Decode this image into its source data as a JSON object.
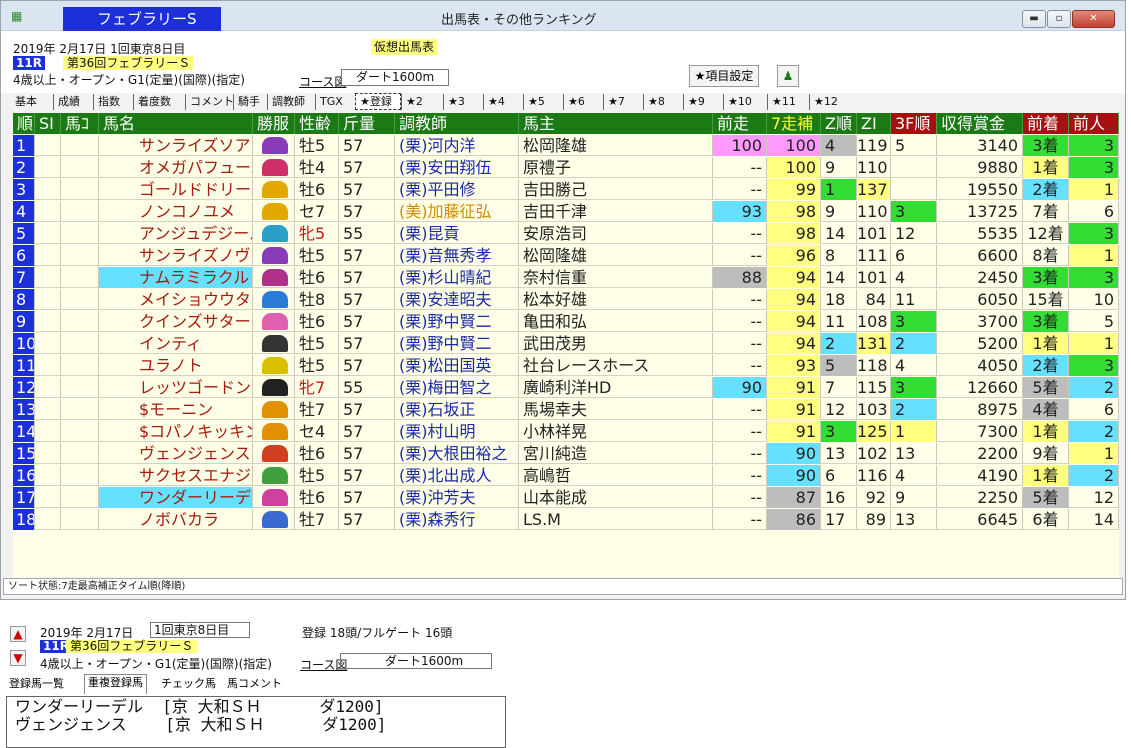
{
  "window": {
    "race_title": "フェブラリーS",
    "title": "出馬表・その他ランキング",
    "min_glyph": "▬",
    "max_glyph": "▫",
    "close_glyph": "✕",
    "app_icon": "ledger-icon"
  },
  "info": {
    "date": "2019年  2月17日      1回東京8日目",
    "race_no": "11R",
    "race_name": "第36回フェブラリーＳ",
    "conditions": "4歳以上・オープン・G1(定量)(国際)(指定)",
    "course_label": "コース図",
    "course": "ダート1600m",
    "yoso": "仮想出馬表",
    "items_button": "★項目設定"
  },
  "tabs": [
    "基本",
    "成績",
    "指数",
    "着度数",
    "コメント",
    "騎手",
    "調教師",
    "TGX",
    "★登録",
    "★2",
    "★3",
    "★4",
    "★5",
    "★6",
    "★7",
    "★8",
    "★9",
    "★10",
    "★11",
    "★12"
  ],
  "active_tab": "★登録",
  "table": {
    "headers": [
      "順",
      "SI",
      "馬ｺ",
      "馬名",
      "勝服",
      "性齢",
      "斤量",
      "調教師",
      "馬主",
      "前走",
      "7走補",
      "Z順",
      "ZI",
      "3F順",
      "収得賞金",
      "前着",
      "前人"
    ],
    "rows": [
      {
        "no": "1",
        "name": "サンライズソア",
        "silk": "#8a3bb8",
        "sex": "牡5",
        "wt": "57",
        "trainer": "(栗)河内洋",
        "owner": "松岡隆雄",
        "prev": "100",
        "r7": "100",
        "z": "4",
        "zi": "119",
        "f3": "5",
        "prize": "3140",
        "pc": "3着",
        "pp": "3"
      },
      {
        "no": "2",
        "name": "オメガパフューム",
        "silk": "#d0306a",
        "sex": "牡4",
        "wt": "57",
        "trainer": "(栗)安田翔伍",
        "owner": "原禮子",
        "prev": "--",
        "r7": "100",
        "z": "9",
        "zi": "110",
        "f3": "",
        "prize": "9880",
        "pc": "1着",
        "pp": "3"
      },
      {
        "no": "3",
        "name": "ゴールドドリーム",
        "silk": "#e2a800",
        "sex": "牡6",
        "wt": "57",
        "trainer": "(栗)平田修",
        "owner": "吉田勝己",
        "prev": "--",
        "r7": "99",
        "z": "1",
        "zi": "137",
        "f3": "",
        "prize": "19550",
        "pc": "2着",
        "pp": "1"
      },
      {
        "no": "4",
        "name": "ノンコノユメ",
        "silk": "#e2a800",
        "sex": "セ7",
        "wt": "57",
        "trainer": "(美)加藤征弘",
        "owner": "吉田千津",
        "prev": "93",
        "r7": "98",
        "z": "9",
        "zi": "110",
        "f3": "3",
        "prize": "13725",
        "pc": "7着",
        "pp": "6"
      },
      {
        "no": "5",
        "name": "アンジュデジール",
        "silk": "#2aa0c8",
        "sex": "牝5",
        "wt": "55",
        "trainer": "(栗)昆貢",
        "owner": "安原浩司",
        "prev": "--",
        "r7": "98",
        "z": "14",
        "zi": "101",
        "f3": "12",
        "prize": "5535",
        "pc": "12着",
        "pp": "3"
      },
      {
        "no": "6",
        "name": "サンライズノヴァ",
        "silk": "#8a3bb8",
        "sex": "牡5",
        "wt": "57",
        "trainer": "(栗)音無秀孝",
        "owner": "松岡隆雄",
        "prev": "--",
        "r7": "96",
        "z": "8",
        "zi": "111",
        "f3": "6",
        "prize": "6600",
        "pc": "8着",
        "pp": "1"
      },
      {
        "no": "7",
        "name": "ナムラミラクル",
        "silk": "#b0308a",
        "sex": "牡6",
        "wt": "57",
        "trainer": "(栗)杉山晴紀",
        "owner": "奈村信重",
        "prev": "88",
        "r7": "94",
        "z": "14",
        "zi": "101",
        "f3": "4",
        "prize": "2450",
        "pc": "3着",
        "pp": "3"
      },
      {
        "no": "8",
        "name": "メイショウウタゲ",
        "silk": "#2a7ad8",
        "sex": "牡8",
        "wt": "57",
        "trainer": "(栗)安達昭夫",
        "owner": "松本好雄",
        "prev": "--",
        "r7": "94",
        "z": "18",
        "zi": "84",
        "f3": "11",
        "prize": "6050",
        "pc": "15着",
        "pp": "10"
      },
      {
        "no": "9",
        "name": "クインズサターン",
        "silk": "#e060b0",
        "sex": "牡6",
        "wt": "57",
        "trainer": "(栗)野中賢二",
        "owner": "亀田和弘",
        "prev": "--",
        "r7": "94",
        "z": "11",
        "zi": "108",
        "f3": "3",
        "prize": "3700",
        "pc": "3着",
        "pp": "5"
      },
      {
        "no": "10",
        "name": "インティ",
        "silk": "#333333",
        "sex": "牡5",
        "wt": "57",
        "trainer": "(栗)野中賢二",
        "owner": "武田茂男",
        "prev": "--",
        "r7": "94",
        "z": "2",
        "zi": "131",
        "f3": "2",
        "prize": "5200",
        "pc": "1着",
        "pp": "1"
      },
      {
        "no": "11",
        "name": "ユラノト",
        "silk": "#d8c000",
        "sex": "牡5",
        "wt": "57",
        "trainer": "(栗)松田国英",
        "owner": "社台レースホース",
        "prev": "--",
        "r7": "93",
        "z": "5",
        "zi": "118",
        "f3": "4",
        "prize": "4050",
        "pc": "2着",
        "pp": "3"
      },
      {
        "no": "12",
        "name": "レッツゴードンキ",
        "silk": "#222222",
        "sex": "牝7",
        "wt": "55",
        "trainer": "(栗)梅田智之",
        "owner": "廣崎利洋HD",
        "prev": "90",
        "r7": "91",
        "z": "7",
        "zi": "115",
        "f3": "3",
        "prize": "12660",
        "pc": "5着",
        "pp": "2"
      },
      {
        "no": "13",
        "name": "$モーニン",
        "silk": "#e09000",
        "sex": "牡7",
        "wt": "57",
        "trainer": "(栗)石坂正",
        "owner": "馬場幸夫",
        "prev": "--",
        "r7": "91",
        "z": "12",
        "zi": "103",
        "f3": "2",
        "prize": "8975",
        "pc": "4着",
        "pp": "6"
      },
      {
        "no": "14",
        "name": "$コパノキッキング",
        "silk": "#e09000",
        "sex": "セ4",
        "wt": "57",
        "trainer": "(栗)村山明",
        "owner": "小林祥晃",
        "prev": "--",
        "r7": "91",
        "z": "3",
        "zi": "125",
        "f3": "1",
        "prize": "7300",
        "pc": "1着",
        "pp": "2"
      },
      {
        "no": "15",
        "name": "ヴェンジェンス",
        "silk": "#d04020",
        "sex": "牡6",
        "wt": "57",
        "trainer": "(栗)大根田裕之",
        "owner": "宮川純造",
        "prev": "--",
        "r7": "90",
        "z": "13",
        "zi": "102",
        "f3": "13",
        "prize": "2200",
        "pc": "9着",
        "pp": "1"
      },
      {
        "no": "16",
        "name": "サクセスエナジー",
        "silk": "#40a040",
        "sex": "牡5",
        "wt": "57",
        "trainer": "(栗)北出成人",
        "owner": "高嶋哲",
        "prev": "--",
        "r7": "90",
        "z": "6",
        "zi": "116",
        "f3": "4",
        "prize": "4190",
        "pc": "1着",
        "pp": "2"
      },
      {
        "no": "17",
        "name": "ワンダーリーデル",
        "silk": "#d040a0",
        "sex": "牡6",
        "wt": "57",
        "trainer": "(栗)沖芳夫",
        "owner": "山本能成",
        "prev": "--",
        "r7": "87",
        "z": "16",
        "zi": "92",
        "f3": "9",
        "prize": "2250",
        "pc": "5着",
        "pp": "12"
      },
      {
        "no": "18",
        "name": "ノボバカラ",
        "silk": "#3a6ad0",
        "sex": "牡7",
        "wt": "57",
        "trainer": "(栗)森秀行",
        "owner": "LS.M",
        "prev": "--",
        "r7": "86",
        "z": "17",
        "zi": "89",
        "f3": "13",
        "prize": "6645",
        "pc": "6着",
        "pp": "14"
      }
    ]
  },
  "status": "ソート状態:7走最高補正タイム順(降順)",
  "bottom": {
    "up_arrow": "▲",
    "down_arrow": "▼",
    "date": "2019年  2月17日",
    "meet": "1回東京8日目",
    "entry": "登録 18頭/フルゲート 16頭",
    "race_no": "11R",
    "race_name": "第36回フェブラリーＳ",
    "conditions": "4歳以上・オープン・G1(定量)(国際)(指定)",
    "course_label": "コース図",
    "course": "ダート1600m",
    "tabs": [
      "登録馬一覧",
      "重複登録馬",
      "チェック馬",
      "馬コメント"
    ],
    "list": [
      "ワンダーリーデル  [京 大和ＳＨ      ダ1200]",
      "ヴェンジェンス    [京 大和ＳＨ      ダ1200]"
    ]
  },
  "colors": {
    "header_green": "#1b7a14",
    "header_red": "#a51010",
    "race_blue": "#1d2fd8",
    "yellow_hl": "#ffff80",
    "magenta_hl": "#ff99ff",
    "cyan_hl": "#66e0ff",
    "green_hl": "#33dd33",
    "grey_hl": "#bdbdbd"
  }
}
